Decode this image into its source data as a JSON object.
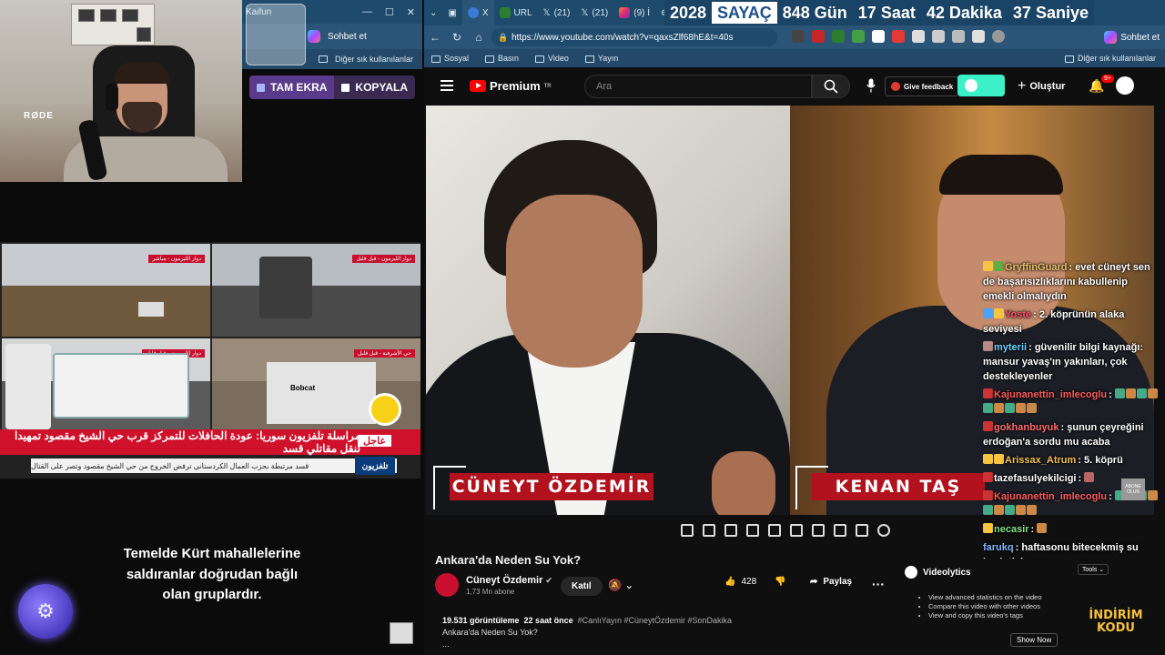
{
  "browser": {
    "tabs": [
      {
        "label": "X"
      },
      {
        "label": "URL"
      },
      {
        "label": "(21)"
      },
      {
        "label": "(21)"
      },
      {
        "label": "(9) İ"
      }
    ],
    "url": "https://www.youtube.com/watch?v=qaxsZlf68hE&t=40s",
    "sohbet": "Sohbet et",
    "bookmarks": [
      "Sosyal",
      "Basın",
      "Video",
      "Yayın"
    ],
    "bookmarks_right": "Diğer sık kullanılanlar"
  },
  "counter": {
    "year": "2028",
    "label": "SAYAÇ",
    "days": "848 Gün",
    "hours": "17 Saat",
    "minutes": "42 Dakika",
    "seconds": "37 Saniye"
  },
  "left_window": {
    "tab_label": "Kaifun",
    "sohbet": "Sohbet et",
    "bookmarks_right": "Diğer sık kullanılanlar"
  },
  "actionbar": {
    "fullscreen": "TAM EKRA",
    "copy": "KOPYALA"
  },
  "news": {
    "headline": "مراسلة تلفزيون سوريا: عودة الحافلات للتمركز قرب حي الشيخ مقصود تمهيدا لنقل مقاتلي قسد",
    "breaking": "عاجل",
    "ticker": "قسد مرتبطة بحزب العمال الكردستاني ترفض الخروج من حي الشيخ مقصود وتصر على القتال",
    "logo": "تلفزيون",
    "cell_tags": [
      "دوار الليرمون - مباشر",
      "دوار الليرمون - قبل قليل",
      "دوار الليرمون - قبل قليل",
      "حي الأشرفية - قبل قليل"
    ],
    "bobcat": "Bobcat"
  },
  "subtitle": "Temelde Kürt mahallelerine saldıranlar doğrudan bağlı olan gruplardır.",
  "youtube": {
    "brand": "Premium",
    "region": "TR",
    "search_placeholder": "Ara",
    "feedback": "Give feedback",
    "create": "Oluştur",
    "notifications": "9+",
    "video_names": [
      "CÜNEYT ÖZDEMİR",
      "KENAN TAŞ"
    ],
    "title": "Ankara'da Neden Su Yok?",
    "channel": "Cüneyt Özdemir",
    "subscribers": "1,73 Mn abone",
    "join": "Katıl",
    "likes": "428",
    "share": "Paylaş",
    "more": "···",
    "views": "19.531 görüntüleme",
    "time": "22 saat önce",
    "hashtags": "#CanlıYayın #CüneytÖzdemir #SonDakika",
    "description": "Ankara'da Neden Su Yok?",
    "desc_more": "..."
  },
  "chat": [
    {
      "user": "GryffinGuard",
      "text": "evet cüneyt sen de başarısızlıklarını kabullenip emekli olmalıydın",
      "color": "#e8c16a"
    },
    {
      "user": "Yoste",
      "text": "2. köprünün alaka seviyesi",
      "color": "#ff4d6d"
    },
    {
      "user": "myterii",
      "text": "güvenilir bilgi kaynağı: mansur yavaş'ın yakınları, çok destekleyenler",
      "color": "#6ad0ff"
    },
    {
      "user": "Kajunanettin_imlecoglu",
      "text": "",
      "color": "#ff5a5a"
    },
    {
      "user": "gokhanbuyuk",
      "text": "şunun çeyreğini erdoğan'a sordu mu acaba",
      "color": "#ff6b6b"
    },
    {
      "user": "Arissax_Atrum",
      "text": "5. köprü",
      "color": "#f2c14e"
    },
    {
      "user": "tazefasulyekilcigi",
      "text": "",
      "color": "#ffffff"
    },
    {
      "user": "Kajunanettin_imlecoglu",
      "text": "",
      "color": "#ff5a5a"
    },
    {
      "user": "necasir",
      "text": "",
      "color": "#7ee081"
    },
    {
      "user": "farukq",
      "text": "haftasonu bitecekmiş su kesintisi",
      "color": "#7fb7ff"
    }
  ],
  "videolytics": {
    "title": "Videolytics",
    "tools": "Tools",
    "items": [
      "View advanced statistics on the video",
      "Compare this video with other videos",
      "View and copy this video's tags"
    ],
    "show": "Show Now"
  },
  "promo": "İNDİRİM KODU",
  "abone": "ABONE OLUN"
}
